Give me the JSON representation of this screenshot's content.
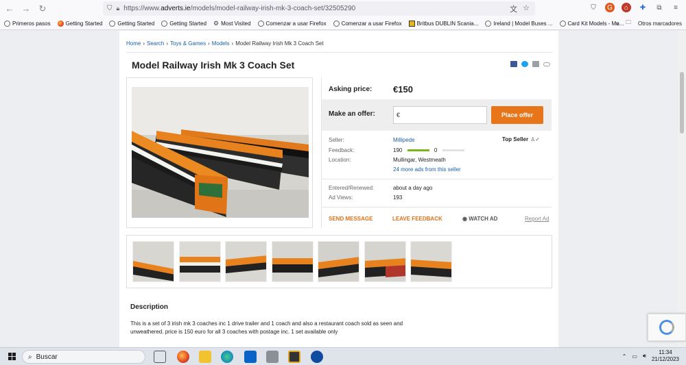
{
  "browser": {
    "url_prefix": "https://www.",
    "url_domain": "adverts.ie",
    "url_path": "/models/model-railway-irish-mk-3-coach-set/32505290",
    "bookmarks": [
      {
        "label": "Primeros pasos",
        "icon": "globe-icon"
      },
      {
        "label": "Getting Started",
        "icon": "firefox-icon"
      },
      {
        "label": "Getting Started",
        "icon": "globe-icon"
      },
      {
        "label": "Getting Started",
        "icon": "globe-icon"
      },
      {
        "label": "Most Visited",
        "icon": "gear-icon"
      },
      {
        "label": "Comenzar a usar Firefox",
        "icon": "globe-icon"
      },
      {
        "label": "Comenzar a usar Firefox",
        "icon": "globe-icon"
      },
      {
        "label": "Britbus DUBLIN Scania...",
        "icon": "bus-icon"
      },
      {
        "label": "Ireland | Model Buses ...",
        "icon": "globe-icon"
      },
      {
        "label": "Card Kit Models - Mo...",
        "icon": "globe-icon"
      }
    ],
    "other_bookmarks": "Otros marcadores"
  },
  "breadcrumb": [
    {
      "label": "Home",
      "link": true
    },
    {
      "label": "Search",
      "link": true
    },
    {
      "label": "Toys & Games",
      "link": true
    },
    {
      "label": "Models",
      "link": true
    },
    {
      "label": "Model Railway Irish Mk 3 Coach Set",
      "link": false
    }
  ],
  "ad": {
    "title": "Model Railway Irish Mk 3 Coach Set",
    "asking_label": "Asking price:",
    "asking_price": "€150",
    "offer_label": "Make an offer:",
    "offer_placeholder": "€",
    "offer_button": "Place offer",
    "seller_label": "Seller:",
    "seller_name": "Millipede",
    "top_seller": "Top Seller",
    "feedback_label": "Feedback:",
    "feedback_positive": "190",
    "feedback_negative": "0",
    "location_label": "Location:",
    "location": "Mullingar, Westmeath",
    "more_ads": "24 more ads from this seller",
    "entered_label": "Entered/Renewed:",
    "entered": "about a day ago",
    "views_label": "Ad Views:",
    "views": "193",
    "send_message": "SEND MESSAGE",
    "leave_feedback": "LEAVE FEEDBACK",
    "watch_ad": "WATCH AD",
    "report_ad": "Report Ad",
    "description_title": "Description",
    "description": "This is a set of 3 irish mk 3 coaches inc 1 drive trailer and 1 coach and also a restaurant coach sold as seen and unweathered. price is 150 euro for all 3 coaches with postage inc. 1 set available only"
  },
  "colors": {
    "accent_orange": "#e7761b",
    "link_blue": "#1a5fa8",
    "feedback_green": "#7cb518"
  },
  "taskbar": {
    "search_placeholder": "Buscar",
    "time": "11:34",
    "date": "21/12/2023"
  }
}
